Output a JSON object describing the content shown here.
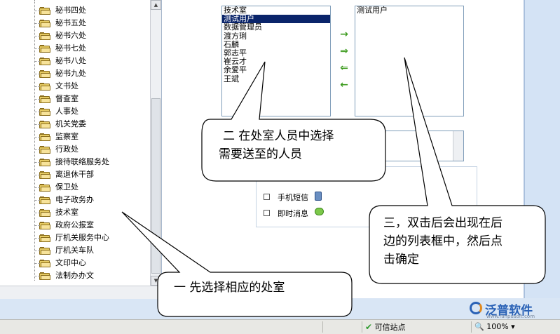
{
  "tree": {
    "items": [
      "秘书四处",
      "秘书五处",
      "秘书六处",
      "秘书七处",
      "秘书八处",
      "秘书九处",
      "文书处",
      "督查室",
      "人事处",
      "机关党委",
      "监察室",
      "行政处",
      "接待联络服务处",
      "离退休干部",
      "保卫处",
      "电子政务办",
      "技术室",
      "政府公报室",
      "厅机关服务中心",
      "厅机关车队",
      "文印中心",
      "法制办办文"
    ]
  },
  "source_list": {
    "items": [
      "技术室",
      "测试用户",
      "数据管理员",
      "渡方琍",
      "石麟",
      "郭志平",
      "崔云才",
      "余爱平",
      "王斌"
    ],
    "selected_index": 1
  },
  "target_list": {
    "items": [
      "测试用户"
    ]
  },
  "arrows": [
    "→",
    "⇒",
    "⇐",
    "←"
  ],
  "options": {
    "sms_label": "手机短信",
    "im_label": "即时消息"
  },
  "callouts": {
    "step1": "一 先选择相应的处室",
    "step2_line1": "二 在处室人员中选择",
    "step2_line2": "需要送至的人员",
    "step3_line1": "三，双击后会出现在后",
    "step3_line2": "边的列表框中，然后点",
    "step3_line3": "击确定"
  },
  "status": {
    "zone": "可信站点",
    "zoom": "100%"
  },
  "logo": {
    "name": "泛普软件",
    "url": "www.fanpusoft.com"
  },
  "colors": {
    "selection": "#0a246a",
    "arrow": "#3d9b1f",
    "folder": "#e6cb63"
  }
}
